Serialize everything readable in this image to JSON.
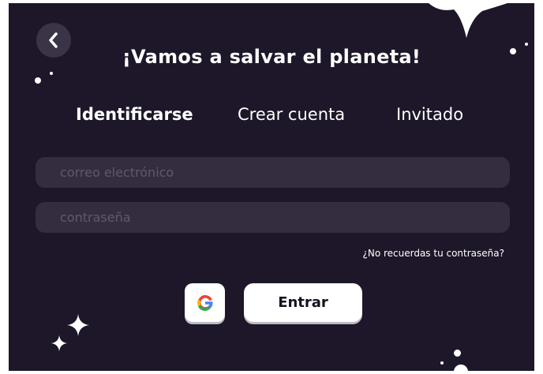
{
  "header": {
    "title": "¡Vamos a salvar el planeta!"
  },
  "tabs": [
    {
      "label": "Identificarse",
      "active": true
    },
    {
      "label": "Crear cuenta",
      "active": false
    },
    {
      "label": "Invitado",
      "active": false
    }
  ],
  "form": {
    "email_placeholder": "correo electrónico",
    "email_value": "",
    "password_placeholder": "contraseña",
    "password_value": "",
    "forgot_label": "¿No recuerdas tu contraseña?",
    "submit_label": "Entrar"
  },
  "icons": {
    "back": "chevron-left-icon",
    "google": "google-icon",
    "sparkles": "sparkle-icon"
  },
  "colors": {
    "background": "#1d1729",
    "field": "#332d3f",
    "back_button": "#3a3446",
    "button": "#ffffff"
  }
}
